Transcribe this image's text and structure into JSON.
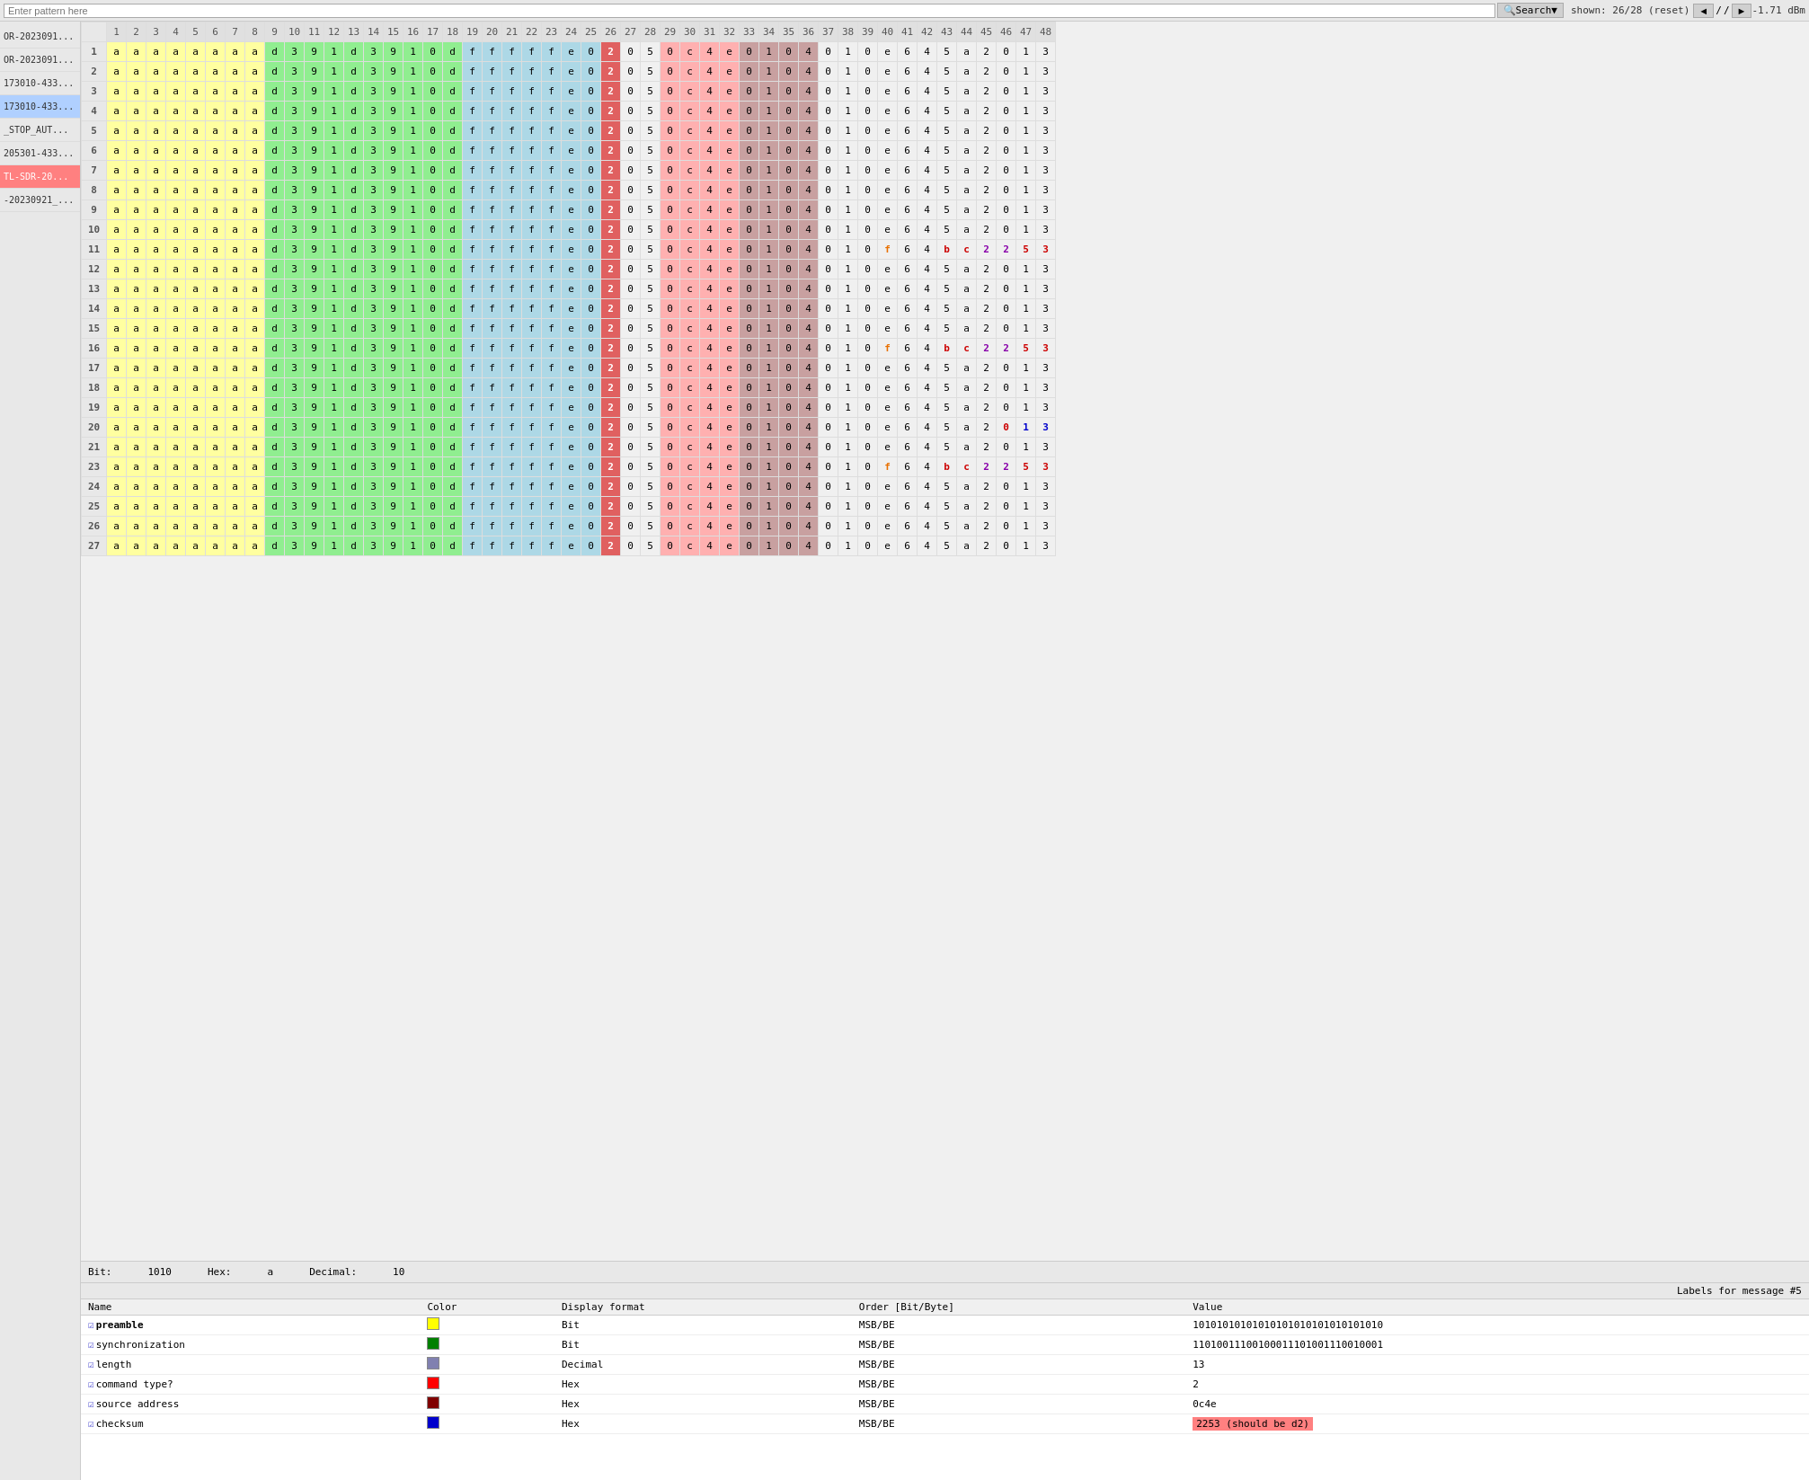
{
  "toolbar": {
    "search_placeholder": "Enter pattern here",
    "search_label": "Search",
    "shown_info": "shown: 26/28 (reset)",
    "nav_prev": "◄",
    "nav_separator": "/",
    "nav_next": "►",
    "signal_info": "-1.71 dBm"
  },
  "sidebar": {
    "items": [
      {
        "id": "item1",
        "label": "OR-2023091...",
        "active": false
      },
      {
        "id": "item2",
        "label": "OR-2023091...",
        "active": false
      },
      {
        "id": "item3",
        "label": "173010-433...",
        "active": false
      },
      {
        "id": "item4",
        "label": "173010-433...",
        "active": true
      },
      {
        "id": "item5",
        "label": "_STOP_AUT...",
        "active": false
      },
      {
        "id": "item6",
        "label": "205301-433...",
        "active": false
      },
      {
        "id": "item7",
        "label": "TL-SDR-20...",
        "active": true,
        "highlighted": true
      },
      {
        "id": "item8",
        "label": "-20230921_...",
        "active": false
      }
    ]
  },
  "col_headers": [
    1,
    2,
    3,
    4,
    5,
    6,
    7,
    8,
    9,
    10,
    11,
    12,
    13,
    14,
    15,
    16,
    17,
    18,
    19,
    20,
    21,
    22,
    23,
    24,
    25,
    26,
    27,
    28,
    29,
    30,
    31,
    32,
    33,
    34,
    35,
    36,
    37,
    38,
    39,
    40,
    41,
    42,
    43,
    44,
    45,
    46,
    47,
    48
  ],
  "status_bar": {
    "bit_label": "Bit:",
    "bit_value": "1010",
    "hex_label": "Hex:",
    "hex_value": "a",
    "decimal_label": "Decimal:",
    "decimal_value": "10"
  },
  "labels_panel": {
    "header": "Labels for message #5",
    "columns": [
      "Name",
      "Color",
      "Display format",
      "Order [Bit/Byte]",
      "Value"
    ],
    "rows": [
      {
        "name": "preamble",
        "color": "#ffff00",
        "display_format": "Bit",
        "order": "MSB/BE",
        "value": "10101010101010101010101010101010",
        "error": false
      },
      {
        "name": "synchronization",
        "color": "#008000",
        "display_format": "Bit",
        "order": "MSB/BE",
        "value": "11010011100100011101001110010001",
        "error": false
      },
      {
        "name": "length",
        "color": "#8080b0",
        "display_format": "Decimal",
        "order": "MSB/BE",
        "value": "13",
        "error": false
      },
      {
        "name": "command type?",
        "color": "#ff0000",
        "display_format": "Hex",
        "order": "MSB/BE",
        "value": "2",
        "error": false
      },
      {
        "name": "source address",
        "color": "#800000",
        "display_format": "Hex",
        "order": "MSB/BE",
        "value": "0c4e",
        "error": false
      },
      {
        "name": "checksum",
        "color": "#0000cc",
        "display_format": "Hex",
        "order": "MSB/BE",
        "value": "2253 (should be d2)",
        "error": true
      }
    ]
  }
}
